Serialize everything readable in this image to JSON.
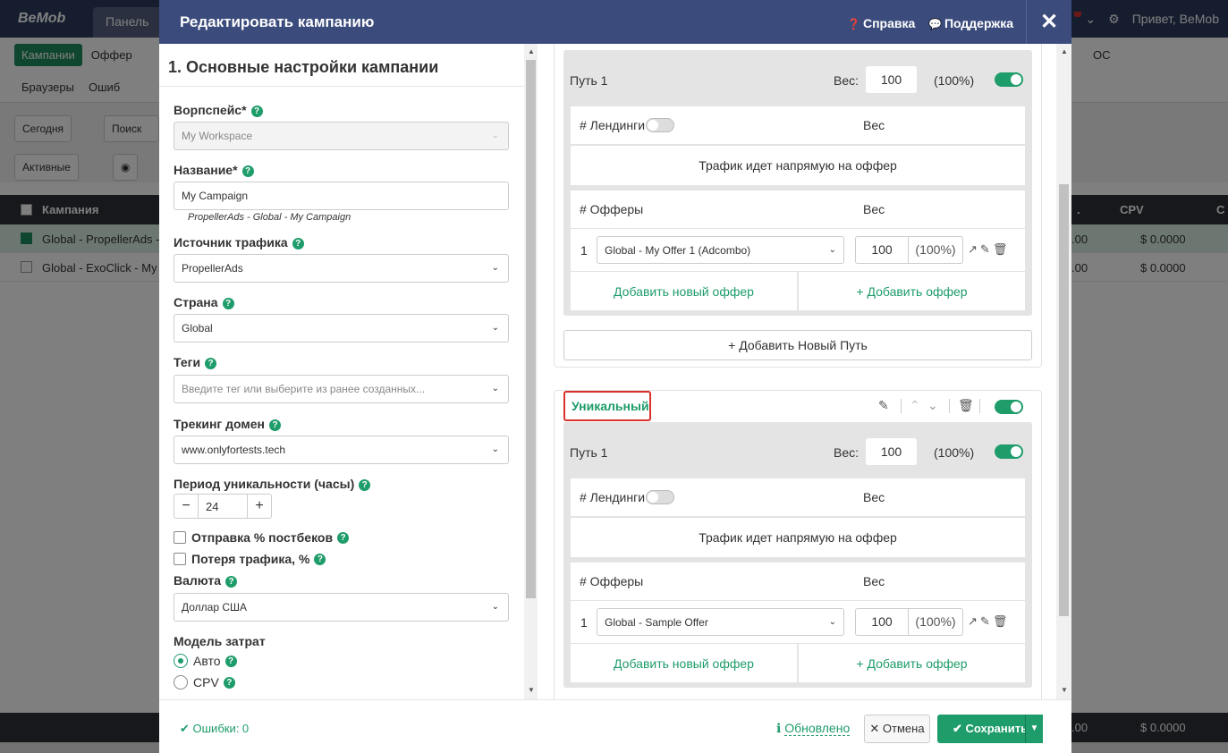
{
  "bg": {
    "logo": "BeMob",
    "tab_panel": "Панель",
    "greeting": "Привет, BeMob",
    "btn_campaigns": "Кампании",
    "menu_offers": "Оффер",
    "menu_os": "ОС",
    "menu_browsers": "Браузеры",
    "menu_errors": "Ошиб",
    "date_filter": "Сегодня",
    "search_ph": "Поиск",
    "status_filter": "Активные",
    "col_campaign": "Кампания",
    "col_cpv": "CPV",
    "col_cut": "C",
    "col_prev": ".",
    "rows": [
      {
        "name": "Global - PropellerAds - My Campaign",
        "left_val": ".00",
        "cpv": "$ 0.0000"
      },
      {
        "name": "Global - ExoClick - My Campaign",
        "left_val": ".00",
        "cpv": "$ 0.0000"
      }
    ],
    "foot_left": ".00",
    "foot_cpv": "$ 0.0000"
  },
  "modal": {
    "title": "Редактировать кампанию",
    "help_label": "Справка",
    "support_label": "Поддержка",
    "close_icon": "close-icon"
  },
  "left": {
    "section_title": "1. Основные настройки кампании",
    "workspace_label": "Ворпспейс*",
    "workspace_value": "My Workspace",
    "name_label": "Название*",
    "name_value": "My Campaign",
    "name_hint": "PropellerAds - Global - My Campaign",
    "source_label": "Источник трафика",
    "source_value": "PropellerAds",
    "country_label": "Страна",
    "country_value": "Global",
    "tags_label": "Теги",
    "tags_placeholder": "Введите тег или выберите из ранее созданных...",
    "domain_label": "Трекинг домен",
    "domain_value": "www.onlyfortests.tech",
    "uniq_period_label": "Период уникальности (часы)",
    "uniq_period_value": "24",
    "postback_label": "Отправка % постбеков",
    "traffic_loss_label": "Потеря трафика, %",
    "currency_label": "Валюта",
    "currency_value": "Доллар США",
    "cost_model_label": "Модель затрат",
    "cost_auto": "Авто",
    "cost_cpv": "CPV"
  },
  "right": {
    "block1": {
      "path_name": "Путь 1",
      "weight_label": "Вес:",
      "weight_value": "100",
      "weight_pct": "(100%)",
      "landers_label": "# Лендинги",
      "weight_col": "Вес",
      "direct_text": "Трафик идет напрямую на оффер",
      "offers_label": "# Офферы",
      "offer_index": "1",
      "offer_name": "Global - My Offer 1 (Adcombo)",
      "offer_weight": "100",
      "offer_pct": "(100%)",
      "add_new_offer": "Добавить новый оффер",
      "add_offer": "+ Добавить оффер"
    },
    "add_path": "+ Добавить Новый Путь",
    "uniq_label": "Уникальный",
    "block2": {
      "path_name": "Путь 1",
      "weight_label": "Вес:",
      "weight_value": "100",
      "weight_pct": "(100%)",
      "landers_label": "# Лендинги",
      "weight_col": "Вес",
      "direct_text": "Трафик идет напрямую на оффер",
      "offers_label": "# Офферы",
      "offer_index": "1",
      "offer_name": "Global - Sample Offer",
      "offer_weight": "100",
      "offer_pct": "(100%)",
      "add_new_offer": "Добавить новый оффер",
      "add_offer": "+ Добавить оффер"
    }
  },
  "footer": {
    "errors": "Ошибки: 0",
    "updated": "Обновлено",
    "cancel": "Отмена",
    "save": "Сохранить"
  },
  "colors": {
    "header": "#3b4c7c",
    "accent": "#1e9c6a",
    "highlight": "#d9312b"
  }
}
